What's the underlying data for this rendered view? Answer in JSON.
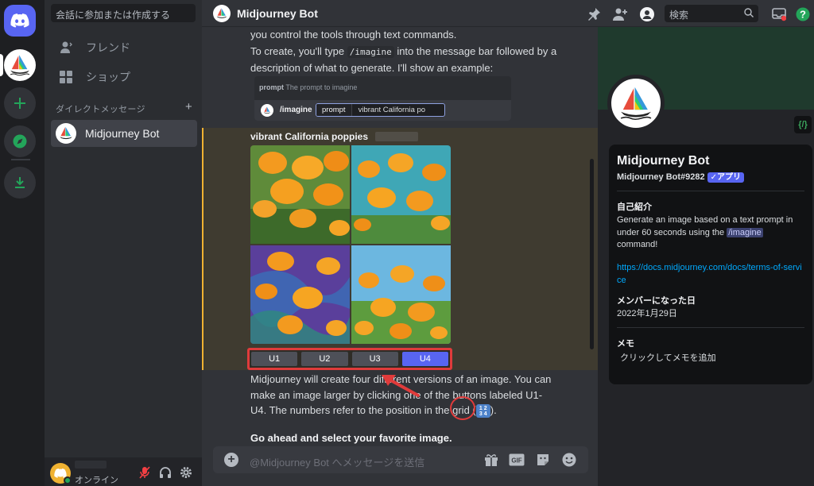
{
  "sidebar": {
    "search_placeholder": "会話に参加または作成する",
    "nav": [
      {
        "label": "フレンド",
        "icon": "friends-icon"
      },
      {
        "label": "ショップ",
        "icon": "shop-icon"
      }
    ],
    "dm_header": "ダイレクトメッセージ",
    "dm_items": [
      {
        "label": "Midjourney Bot"
      }
    ],
    "user_status": "オンライン"
  },
  "header": {
    "title": "Midjourney Bot",
    "search_placeholder": "検索"
  },
  "chat": {
    "line0": "you control the tools through text commands.",
    "p1_a": "To create, you'll type ",
    "p1_code": "/imagine",
    "p1_b": " into the message bar followed by a description of what to generate. I'll show an example:",
    "prompt_label": "prompt",
    "prompt_hint": "The prompt to imagine",
    "prompt_cmd": "/imagine",
    "prompt_field_name": "prompt",
    "prompt_value": "vibrant California po",
    "image_title": "vibrant California poppies",
    "buttons": [
      "U1",
      "U2",
      "U3",
      "U4"
    ],
    "p2_a": "Midjourney will create four different versions of an image. You can make an image larger by clicking one of the buttons labeled U1-U4. The numbers refer to the position in the grid (",
    "p2_b": ").",
    "badge_top": "1 2",
    "badge_bottom": "3 4",
    "p3": "Go ahead and select your favorite image.",
    "composer_placeholder": "@Midjourney Bot へメッセージを送信"
  },
  "profile": {
    "name": "Midjourney Bot",
    "tag": "Midjourney Bot#9282",
    "app_badge": "✓アプリ",
    "code_badge": "{/}",
    "about_heading": "自己紹介",
    "about_a": "Generate an image based on a text prompt in under 60 seconds using the ",
    "about_cmd": "/imagine",
    "about_b": " command!",
    "link": "https://docs.midjourney.com/docs/terms-of-service",
    "member_heading": "メンバーになった日",
    "member_date": "2022年1月29日",
    "memo_heading": "メモ",
    "memo_placeholder": "クリックしてメモを追加"
  },
  "colors": {
    "blurple": "#5865f2",
    "highlight_red": "#e03b3b",
    "online_green": "#23a55a"
  }
}
